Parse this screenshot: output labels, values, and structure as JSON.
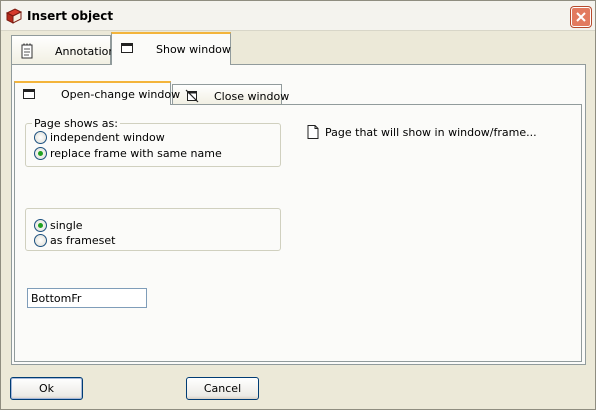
{
  "window": {
    "title": "Insert object",
    "title_icon": "red-book-icon",
    "close_icon": "close-icon"
  },
  "outer_tabs": [
    {
      "label": "Annotation",
      "icon": "notepad-icon",
      "active": false
    },
    {
      "label": "Show window",
      "icon": "window-icon",
      "active": true
    }
  ],
  "inner_tabs": [
    {
      "label": "Open-change window",
      "icon": "window-icon",
      "active": true
    },
    {
      "label": "Close window",
      "icon": "close-window-icon",
      "active": false
    }
  ],
  "page_shows": {
    "legend": "Page shows as:",
    "options": [
      {
        "label": "independent window",
        "checked": false
      },
      {
        "label": "replace frame with same name",
        "checked": true
      }
    ]
  },
  "layout_mode": {
    "options": [
      {
        "label": "single",
        "checked": true
      },
      {
        "label": "as frameset",
        "checked": false
      }
    ]
  },
  "target_page": {
    "label": "Page that will show in window/frame...",
    "icon": "document-icon"
  },
  "frame_name": {
    "value": "BottomFr"
  },
  "buttons": {
    "ok": "Ok",
    "cancel": "Cancel"
  },
  "colors": {
    "tab_highlight": "#f3b43b",
    "radio_dot": "#21a121",
    "close_button": "#e27a5f"
  }
}
